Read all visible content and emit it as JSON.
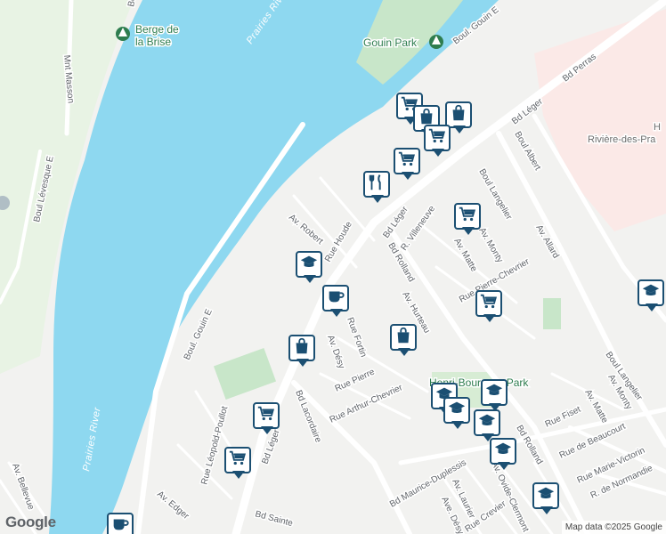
{
  "map": {
    "colors": {
      "water": "#8ed8f0",
      "park": "#c8e6c9",
      "hospital": "#fde8e8",
      "road": "#ffffff",
      "background": "#f2f2f0"
    },
    "water_labels": [
      "Prairies River",
      "Prairies River"
    ],
    "park_labels": {
      "berge_line1": "Berge de",
      "berge_line2": "la Brise",
      "gouin": "Gouin Park",
      "henri": "Henri-Bourassa Park"
    },
    "area_labels": {
      "hospital_prefix": "H",
      "hospital": "Rivière-des-Pra"
    },
    "street_labels": {
      "boul_gouin_e_top": "Boul. Gouin E",
      "mnt_masson": "Mnt Masson",
      "boul_levesque": "Boul Lévesque E",
      "bd_perras": "Bd Perras",
      "bd_leger_top": "Bd Léger",
      "boul_albert": "Boul Albert",
      "av_allard": "Av. Allard",
      "boul_langelier_top": "Boul Langelier",
      "boul_gouin_e": "Boul. Gouin E",
      "av_robert": "Av. Robert",
      "rue_houde": "Rue Houde",
      "bd_leger_mid": "Bd Léger",
      "r_villeneuve": "R. Villeneuve",
      "av_monty_top": "Av. Monty",
      "av_matte_top": "Av. Matte",
      "bd_rolland_top": "Bd Rolland",
      "av_hurteau": "Av. Hurteau",
      "rue_pierre_chevrier": "Rue Pierre-Chevrier",
      "rue_fortin": "Rue Fortin",
      "av_desy": "Av. Désy",
      "rue_pierre": "Rue Pierre",
      "rue_arthur_chevrier": "Rue Arthur-Chevrier",
      "rue_leopold_poullot": "Rue Léopold-Poullot",
      "bd_lacordaire": "Bd Lacordaire",
      "bd_leger_bottom": "Bd Léger",
      "av_bellevue": "Av. Bellevue",
      "av_edger": "Av. Edger",
      "bd_sainte": "Bd Sainte",
      "bd_maurice_duplessis": "Bd Maurice-Duplessis",
      "av_laurier": "Av. Laurier",
      "av_ovide_clermont": "Av. Ovide-Clermont",
      "ave_desy": "Ave. Désy",
      "rue_crevier": "Rue Crevier",
      "bd_rolland_bottom": "Bd Rolland",
      "rue_fiset": "Rue Fiset",
      "rue_de_beaucourt": "Rue de Beaucourt",
      "rue_marie_victorin": "Rue Marie-Victorin",
      "r_de_normandie": "R. de Normandie",
      "av_monty_bottom": "Av. Monty",
      "av_matte_bottom": "Av. Matte",
      "boul_langelier_bottom": "Boul Langelier"
    },
    "pins": [
      {
        "icon": "shopping-cart-icon",
        "label": "Grocery"
      },
      {
        "icon": "shopping-bag-icon",
        "label": "Store"
      },
      {
        "icon": "shopping-bag-icon",
        "label": "Store"
      },
      {
        "icon": "shopping-cart-icon",
        "label": "Grocery"
      },
      {
        "icon": "restaurant-icon",
        "label": "Restaurant"
      },
      {
        "icon": "shopping-cart-icon",
        "label": "Grocery"
      },
      {
        "icon": "shopping-cart-icon",
        "label": "Grocery"
      },
      {
        "icon": "school-icon",
        "label": "School"
      },
      {
        "icon": "school-icon",
        "label": "School"
      },
      {
        "icon": "cafe-icon",
        "label": "Cafe"
      },
      {
        "icon": "shopping-cart-icon",
        "label": "Grocery"
      },
      {
        "icon": "shopping-bag-icon",
        "label": "Store"
      },
      {
        "icon": "shopping-bag-icon",
        "label": "Store"
      },
      {
        "icon": "school-icon",
        "label": "School"
      },
      {
        "icon": "school-icon",
        "label": "School"
      },
      {
        "icon": "school-icon",
        "label": "School"
      },
      {
        "icon": "shopping-cart-icon",
        "label": "Grocery"
      },
      {
        "icon": "shopping-cart-icon",
        "label": "Grocery"
      },
      {
        "icon": "school-icon",
        "label": "School"
      },
      {
        "icon": "school-icon",
        "label": "School"
      },
      {
        "icon": "school-icon",
        "label": "School"
      },
      {
        "icon": "cafe-icon",
        "label": "Cafe"
      }
    ],
    "branding": "Google",
    "attribution": "Map data ©2025 Google"
  }
}
